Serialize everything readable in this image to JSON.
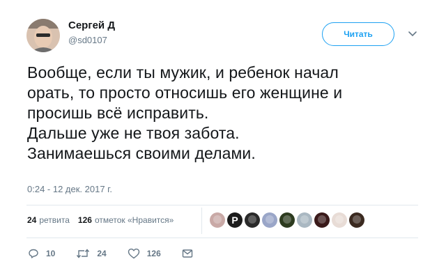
{
  "author": {
    "name": "Сергей Д",
    "handle": "@sd0107"
  },
  "follow_button": {
    "label": "Читать"
  },
  "tweet": {
    "lines": [
      "Вообще, если ты мужик, и ребенок начал",
      "орать, то просто относишь его женщине и",
      "просишь всё исправить.",
      "Дальше уже не твоя забота.",
      "Занимаешься своими делами."
    ],
    "timestamp": "0:24 - 12 дек. 2017 г."
  },
  "stats": {
    "retweets_count": "24",
    "retweets_label": "ретвита",
    "likes_count": "126",
    "likes_label": "отметок «Нравится»"
  },
  "liker_avatars": [
    {
      "color": "#c9a9a6"
    },
    {
      "color": "#1b1b1b",
      "letter": "P"
    },
    {
      "color": "#2a2a2a"
    },
    {
      "color": "#9aa6c8"
    },
    {
      "color": "#2d3b1f"
    },
    {
      "color": "#aab8c2"
    },
    {
      "color": "#3a1a1a"
    },
    {
      "color": "#e8dcd6"
    },
    {
      "color": "#3b2a20"
    }
  ],
  "actions": {
    "replies": "10",
    "retweets": "24",
    "likes": "126"
  },
  "colors": {
    "accent": "#1da1f2",
    "secondary_text": "#657786",
    "divider": "#e1e8ed"
  }
}
